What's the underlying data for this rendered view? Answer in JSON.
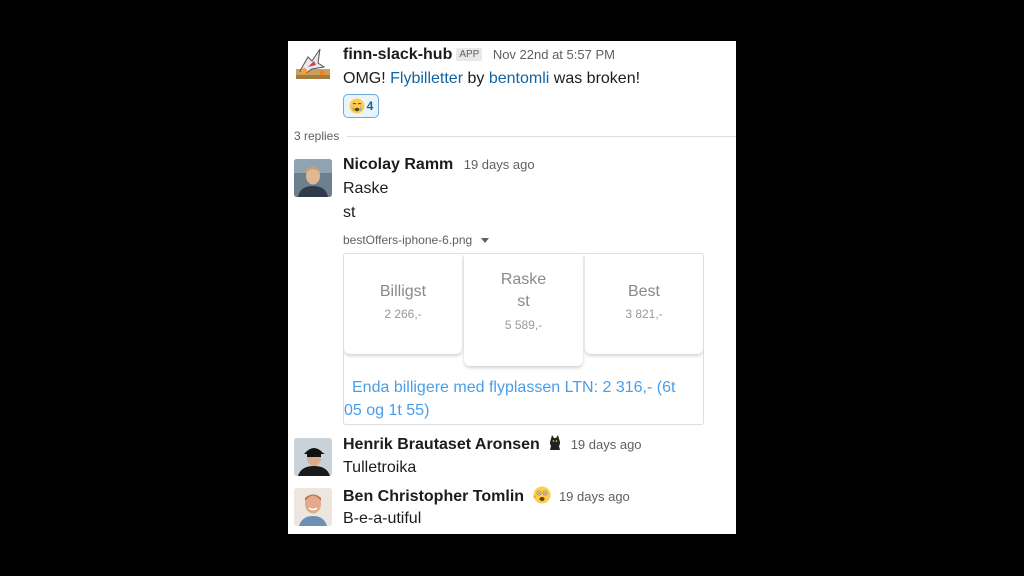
{
  "thread": {
    "root": {
      "author": "finn-slack-hub",
      "badge": "APP",
      "timestamp": "Nov 22nd at 5:57 PM",
      "text_prefix": "OMG!",
      "link1": "Flybilletter",
      "text_by": "by",
      "link2": "bentomli",
      "text_suffix": "was broken!",
      "reaction": {
        "icon": "crying-face-icon",
        "count": "4"
      }
    },
    "replies_label": "3 replies",
    "replies": [
      {
        "author": "Nicolay Ramm",
        "timestamp": "19 days ago",
        "lines": [
          "Raske",
          "st"
        ],
        "file": {
          "name": "bestOffers-iphone-6.png",
          "cards": [
            {
              "title": "Billigst",
              "price": "2 266,-"
            },
            {
              "title_line1": "Raske",
              "title_line2": "st",
              "price": "5 589,-"
            },
            {
              "title": "Best",
              "price": "3 821,-"
            }
          ],
          "promo": "Enda billigere med flyplassen LTN: 2 316,- (6t 05 og 1t 55)"
        }
      },
      {
        "author": "Henrik Brautaset Aronsen",
        "status_icon": "cat-icon",
        "timestamp": "19 days ago",
        "text": "Tulletroika"
      },
      {
        "author": "Ben Christopher Tomlin",
        "status_icon": "shocked-face-icon",
        "timestamp": "19 days ago",
        "text": "B-e-a-utiful"
      }
    ]
  }
}
